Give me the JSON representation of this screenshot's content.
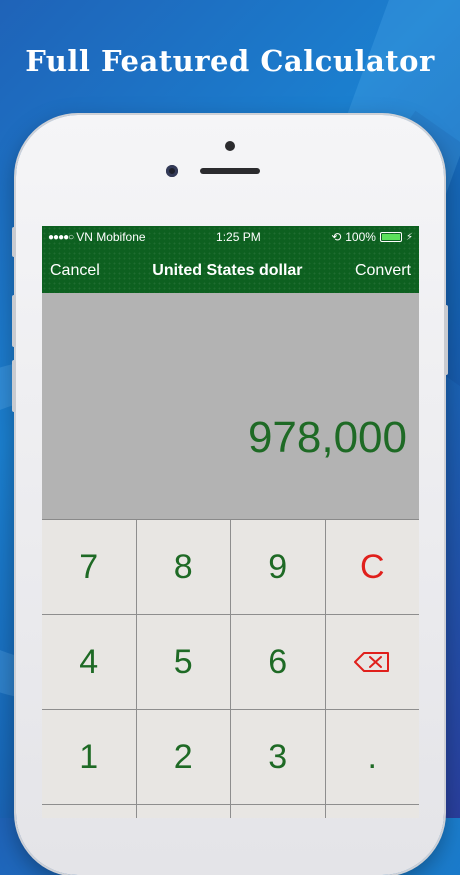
{
  "promo": {
    "title": "Full Featured Calculator"
  },
  "status": {
    "carrier": "VN Mobifone",
    "time": "1:25 PM",
    "battery": "100%",
    "signal": "●●●●○"
  },
  "nav": {
    "cancel": "Cancel",
    "title": "United States dollar",
    "convert": "Convert"
  },
  "display": {
    "value": "978,000"
  },
  "keys": [
    {
      "label": "7",
      "color": "green"
    },
    {
      "label": "8",
      "color": "green"
    },
    {
      "label": "9",
      "color": "green"
    },
    {
      "label": "C",
      "color": "red"
    },
    {
      "label": "4",
      "color": "green"
    },
    {
      "label": "5",
      "color": "green"
    },
    {
      "label": "6",
      "color": "green"
    },
    {
      "label": "",
      "icon": "backspace-icon",
      "color": "red"
    },
    {
      "label": "1",
      "color": "green"
    },
    {
      "label": "2",
      "color": "green"
    },
    {
      "label": "3",
      "color": "green"
    },
    {
      "label": ".",
      "color": "green"
    }
  ],
  "colors": {
    "bar_green": "#0d6020",
    "digit_green": "#1e6a25",
    "clear_red": "#e0201c",
    "display_gray": "#b3b3b3",
    "key_bg": "#e8e6e3"
  }
}
